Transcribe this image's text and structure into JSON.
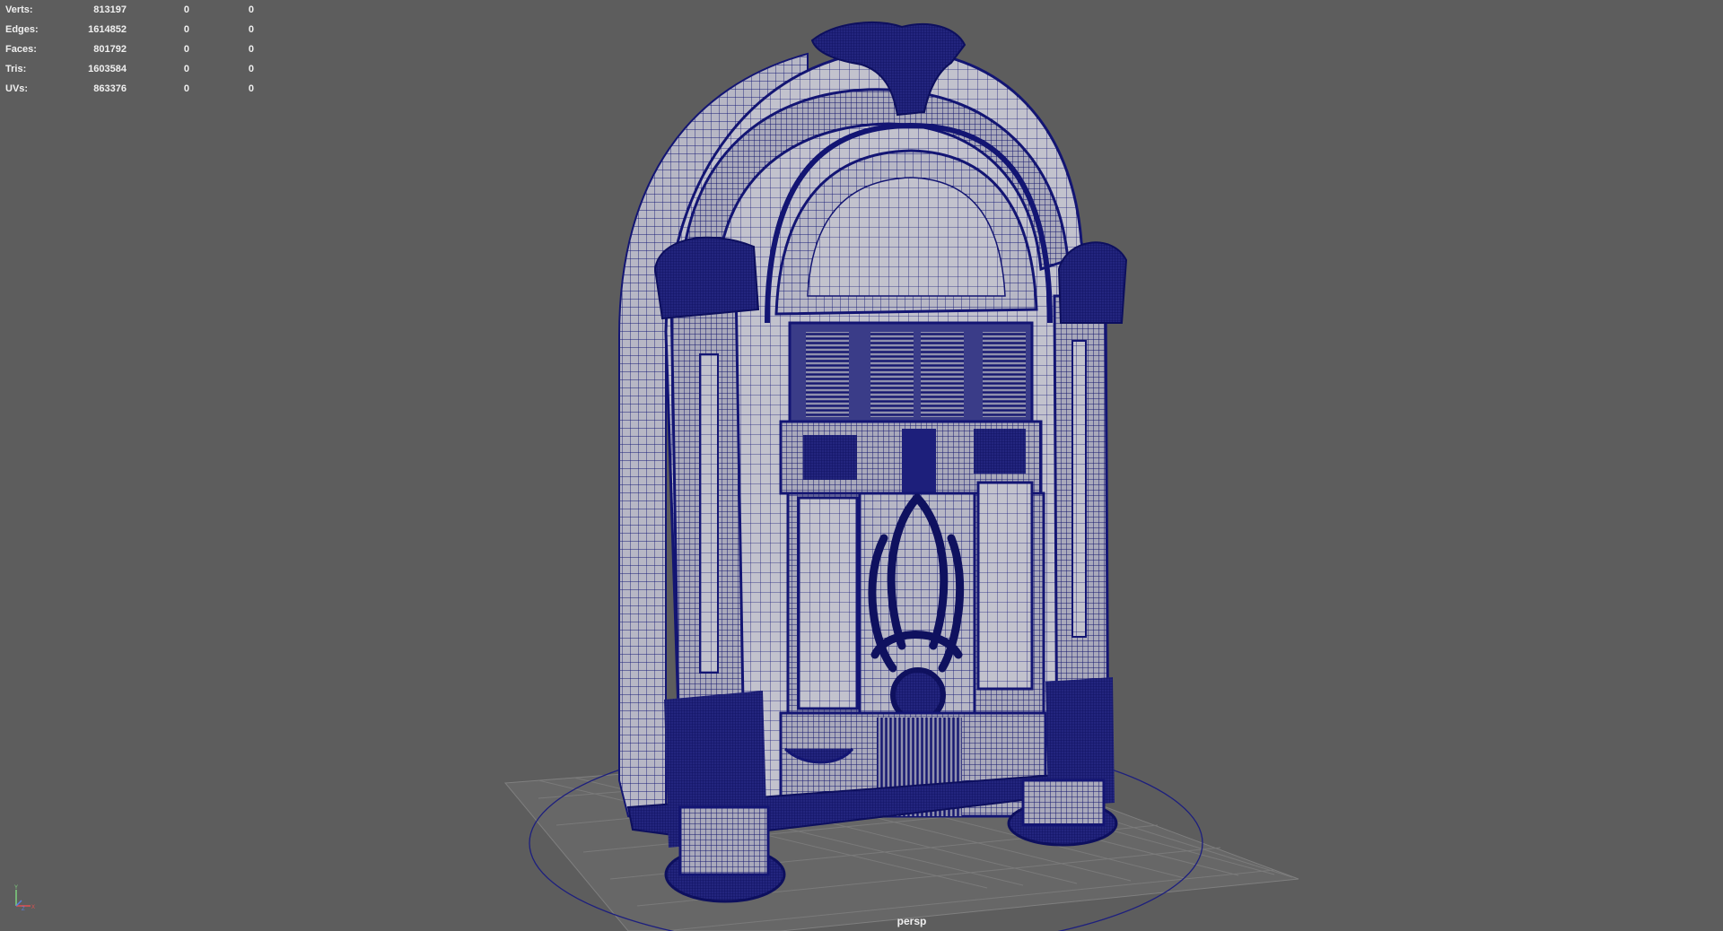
{
  "hud": {
    "rows": [
      {
        "label": "Verts:",
        "v1": "813197",
        "v2": "0",
        "v3": "0"
      },
      {
        "label": "Edges:",
        "v1": "1614852",
        "v2": "0",
        "v3": "0"
      },
      {
        "label": "Faces:",
        "v1": "801792",
        "v2": "0",
        "v3": "0"
      },
      {
        "label": "Tris:",
        "v1": "1603584",
        "v2": "0",
        "v3": "0"
      },
      {
        "label": "UVs:",
        "v1": "863376",
        "v2": "0",
        "v3": "0"
      }
    ]
  },
  "viewport": {
    "camera": "persp",
    "background": "#5d5d5d",
    "wire_color": "#131573",
    "shade_color": "#b9b9c6",
    "grid_color": "#8a8a8a"
  },
  "axis_gizmo": {
    "y_label": "Y",
    "x_label": "X",
    "z_label": "Z"
  }
}
